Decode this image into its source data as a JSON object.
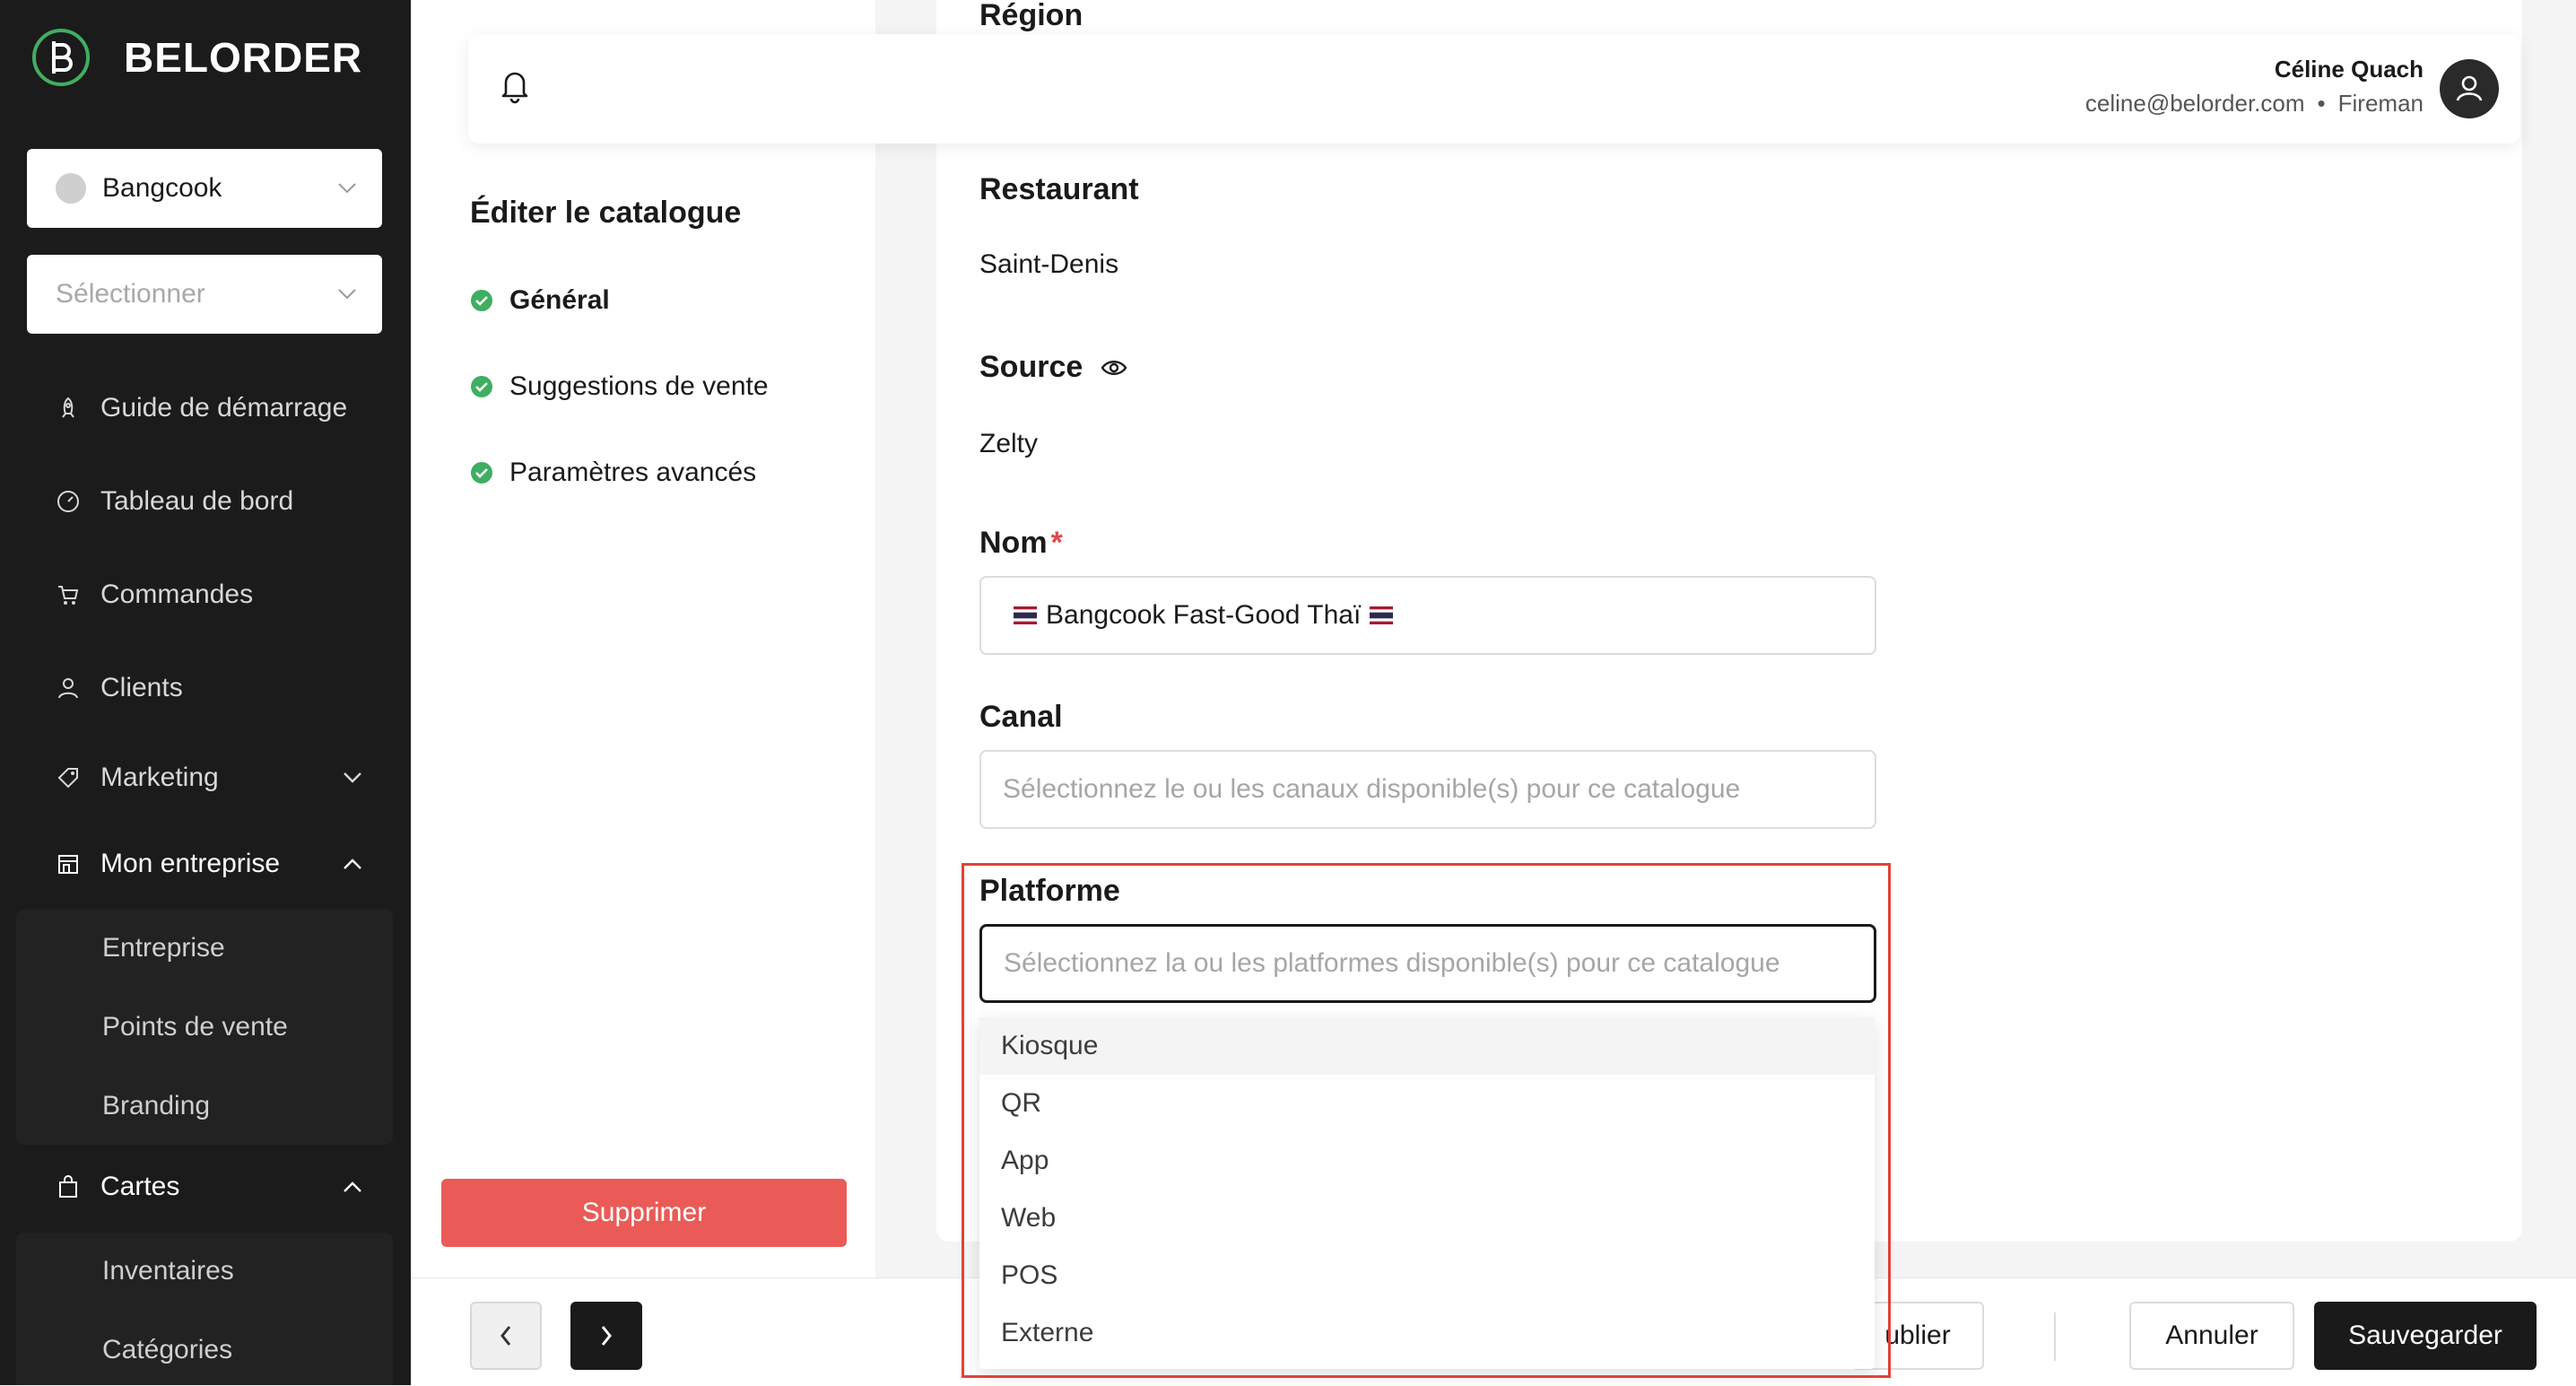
{
  "app": {
    "name": "BELORDER"
  },
  "sidebar": {
    "store_select": {
      "value": "Bangcook"
    },
    "secondary_select": {
      "placeholder": "Sélectionner"
    },
    "items": [
      {
        "label": "Guide de démarrage",
        "icon": "rocket-icon"
      },
      {
        "label": "Tableau de bord",
        "icon": "dashboard-icon"
      },
      {
        "label": "Commandes",
        "icon": "cart-icon"
      },
      {
        "label": "Clients",
        "icon": "user-icon"
      },
      {
        "label": "Marketing",
        "icon": "tag-icon"
      },
      {
        "label": "Mon entreprise",
        "icon": "store-icon"
      },
      {
        "label": "Cartes",
        "icon": "bag-icon"
      }
    ],
    "mon_entreprise_sub": [
      "Entreprise",
      "Points de vente",
      "Branding"
    ],
    "cartes_sub": [
      "Inventaires",
      "Catégories"
    ]
  },
  "steps": {
    "title": "Éditer le catalogue",
    "items": [
      "Général",
      "Suggestions de vente",
      "Paramètres avancés"
    ],
    "delete_label": "Supprimer"
  },
  "header": {
    "user_name": "Céline Quach",
    "user_email": "celine@belorder.com",
    "separator": "•",
    "user_role": "Fireman"
  },
  "form": {
    "region_label": "Région",
    "restaurant_label": "Restaurant",
    "restaurant_value": "Saint-Denis",
    "source_label": "Source",
    "source_value": "Zelty",
    "name_label": "Nom",
    "name_required": "*",
    "name_value": "Bangcook Fast-Good Thaï",
    "canal_label": "Canal",
    "canal_placeholder": "Sélectionnez le ou les canaux disponible(s) pour ce catalogue",
    "platform_label": "Platforme",
    "platform_placeholder": "Sélectionnez la ou les platformes disponible(s) pour ce catalogue",
    "platform_options": [
      "Kiosque",
      "QR",
      "App",
      "Web",
      "POS",
      "Externe"
    ]
  },
  "footer": {
    "publish_label": "ublier",
    "cancel_label": "Annuler",
    "save_label": "Sauvegarder"
  },
  "colors": {
    "sidebar_bg": "#1b1b1b",
    "delete_red": "#ea5b57",
    "check_green": "#3fae62",
    "highlight_red": "#e2413a"
  }
}
